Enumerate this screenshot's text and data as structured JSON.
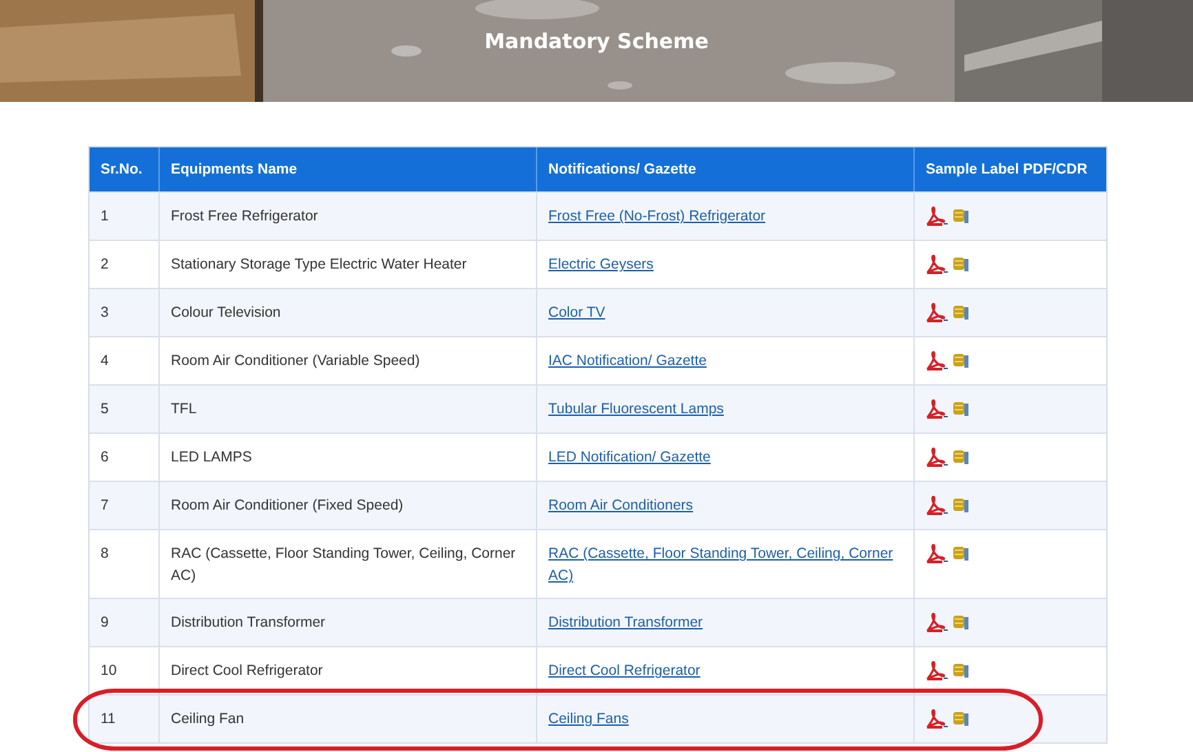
{
  "banner": {
    "title": "Mandatory Scheme",
    "kind": "picture"
  },
  "table": {
    "columns": [
      "Sr.No.",
      "Equipments Name",
      "Notifications/ Gazette",
      "Sample Label PDF/CDR"
    ],
    "rows": [
      {
        "sr": "1",
        "name": "Frost Free Refrigerator",
        "link": "Frost Free (No-Frost) Refrigerator",
        "highlighted": false
      },
      {
        "sr": "2",
        "name": "Stationary Storage Type Electric Water Heater",
        "link": "Electric Geysers",
        "highlighted": false
      },
      {
        "sr": "3",
        "name": "Colour Television",
        "link": "Color TV",
        "highlighted": false
      },
      {
        "sr": "4",
        "name": "Room Air Conditioner (Variable Speed)",
        "link": "IAC Notification/ Gazette",
        "highlighted": false
      },
      {
        "sr": "5",
        "name": "TFL",
        "link": "Tubular Fluorescent Lamps",
        "highlighted": false
      },
      {
        "sr": "6",
        "name": "LED LAMPS",
        "link": "LED Notification/ Gazette",
        "highlighted": false
      },
      {
        "sr": "7",
        "name": "Room Air Conditioner (Fixed Speed)",
        "link": "Room Air Conditioners",
        "highlighted": false
      },
      {
        "sr": "8",
        "name": "RAC (Cassette, Floor Standing Tower, Ceiling, Corner AC)",
        "link": "RAC (Cassette, Floor Standing Tower, Ceiling, Corner AC)",
        "highlighted": false
      },
      {
        "sr": "9",
        "name": "Distribution Transformer",
        "link": "Distribution Transformer",
        "highlighted": false
      },
      {
        "sr": "10",
        "name": "Direct Cool Refrigerator",
        "link": "Direct Cool Refrigerator",
        "highlighted": false
      },
      {
        "sr": "11",
        "name": "Ceiling Fan",
        "link": "Ceiling Fans",
        "highlighted": true
      }
    ]
  }
}
